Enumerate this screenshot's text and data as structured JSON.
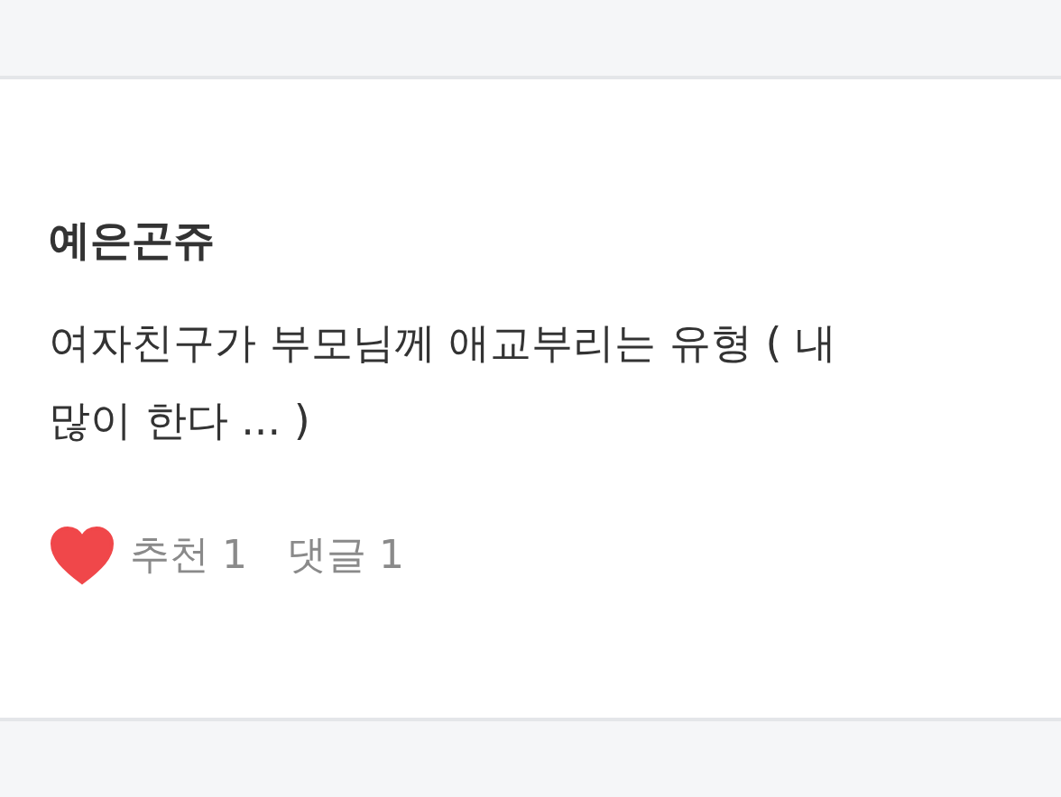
{
  "post": {
    "author": "예은곤쥬",
    "body_lines": [
      "여자친구가 부모님께 애교부리는 유형 ( 내",
      "많이 한다 ... )"
    ],
    "liked": true,
    "likes_label": "추천 1",
    "comments_label": "댓글 1"
  }
}
